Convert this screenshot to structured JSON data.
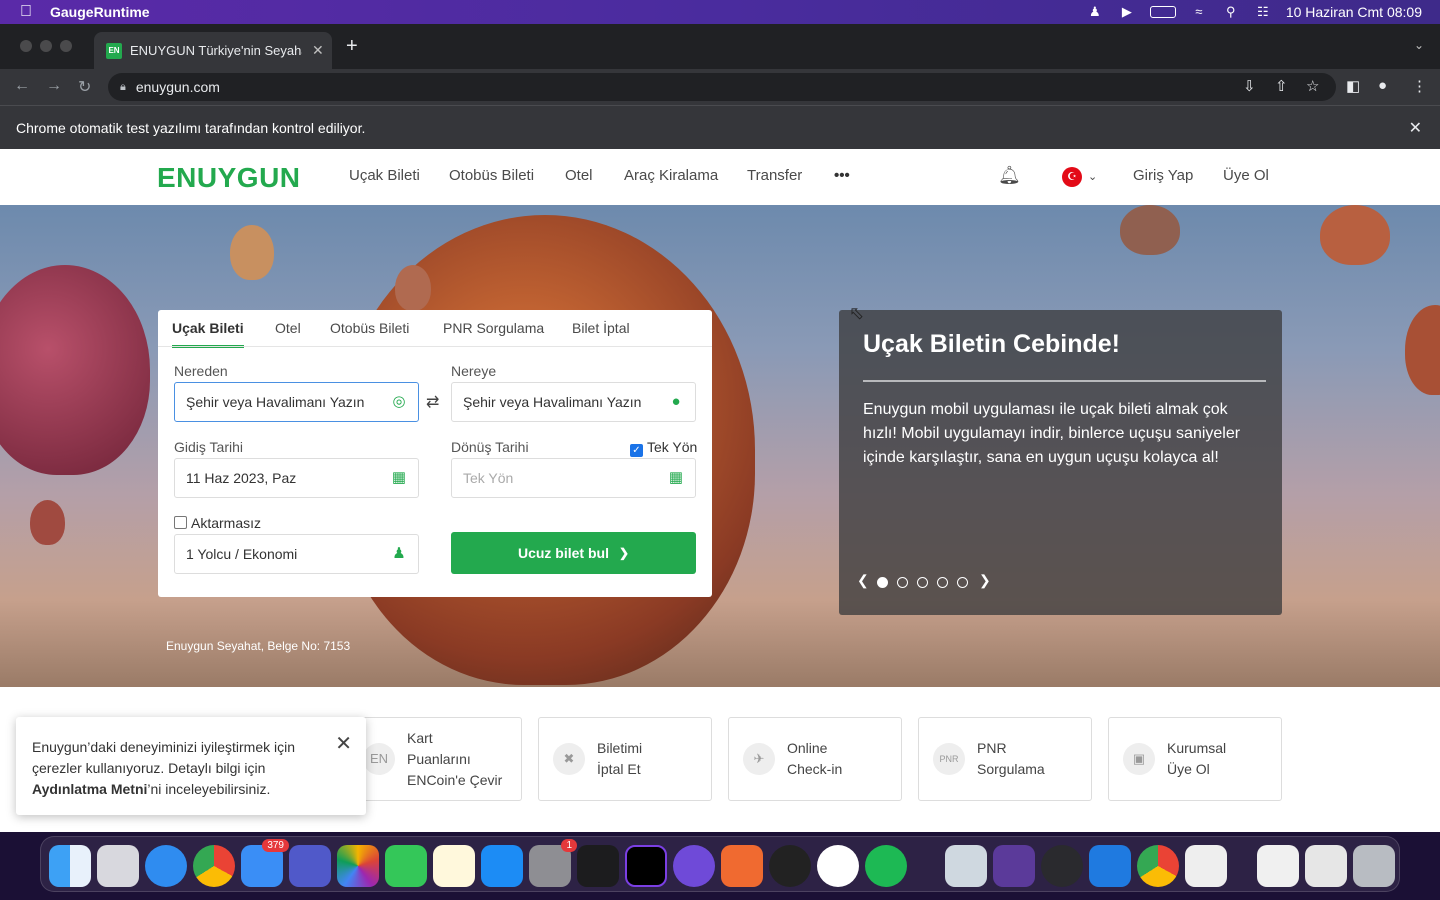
{
  "menubar": {
    "app_name": "GaugeRuntime",
    "datetime": "10 Haziran Cmt  08:09"
  },
  "browser": {
    "tab_title": "ENUYGUN Türkiye'nin Seyahat",
    "favicon_text": "EN",
    "url": "enuygun.com",
    "automation_notice": "Chrome otomatik test yazılımı tarafından kontrol ediliyor."
  },
  "site": {
    "logo": "ENUYGUN",
    "nav": [
      "Uçak Bileti",
      "Otobüs Bileti",
      "Otel",
      "Araç Kiralama",
      "Transfer"
    ],
    "more": "•••",
    "login": "Giriş Yap",
    "signup": "Üye Ol"
  },
  "search": {
    "tabs": [
      "Uçak Bileti",
      "Otel",
      "Otobüs Bileti",
      "PNR Sorgulama",
      "Bilet İptal"
    ],
    "from_label": "Nereden",
    "from_placeholder": "Şehir veya Havalimanı Yazın",
    "to_label": "Nereye",
    "to_placeholder": "Şehir veya Havalimanı Yazın",
    "depart_label": "Gidiş Tarihi",
    "depart_value": "11 Haz 2023, Paz",
    "return_label": "Dönüş Tarihi",
    "one_way_label": "Tek Yön",
    "one_way_checked": true,
    "return_placeholder": "Tek Yön",
    "direct_label": "Aktarmasız",
    "direct_checked": false,
    "passengers_value": "1 Yolcu / Ekonomi",
    "submit": "Ucuz bilet bul"
  },
  "promo": {
    "title": "Uçak Biletin Cebinde!",
    "text": "Enuygun mobil uygulaması ile uçak bileti almak çok hızlı! Mobil uygulamayı indir, binlerce uçuşu saniyeler içinde karşılaştır, sana en uygun uçuşu kolayca al!",
    "slides_total": 5,
    "active_slide": 1
  },
  "license": "Enuygun Seyahat, Belge No: 7153",
  "quick_links": [
    {
      "line1": "Kart",
      "line2": "Puanlarını",
      "line3": "ENCoin'e Çevir",
      "icon": "coin-icon"
    },
    {
      "line1": "Biletimi",
      "line2": "İptal Et",
      "icon": "cancel-ticket-icon"
    },
    {
      "line1": "Online",
      "line2": "Check-in",
      "icon": "plane-icon"
    },
    {
      "line1": "PNR",
      "line2": "Sorgulama",
      "icon": "pnr-icon"
    },
    {
      "line1": "Kurumsal",
      "line2": "Üye Ol",
      "icon": "briefcase-icon"
    }
  ],
  "cookie": {
    "text_before": "Enuygun’daki deneyiminizi iyileştirmek için çerezler kullanıyoruz. Detaylı bilgi için ",
    "link": "Aydınlatma Metni",
    "text_after": "’ni inceleyebilirsiniz."
  },
  "dock": {
    "mail_badge": "379",
    "settings_badge": "1"
  },
  "colors": {
    "brand_green": "#23a94e",
    "menubar": "#4a2c9e"
  }
}
